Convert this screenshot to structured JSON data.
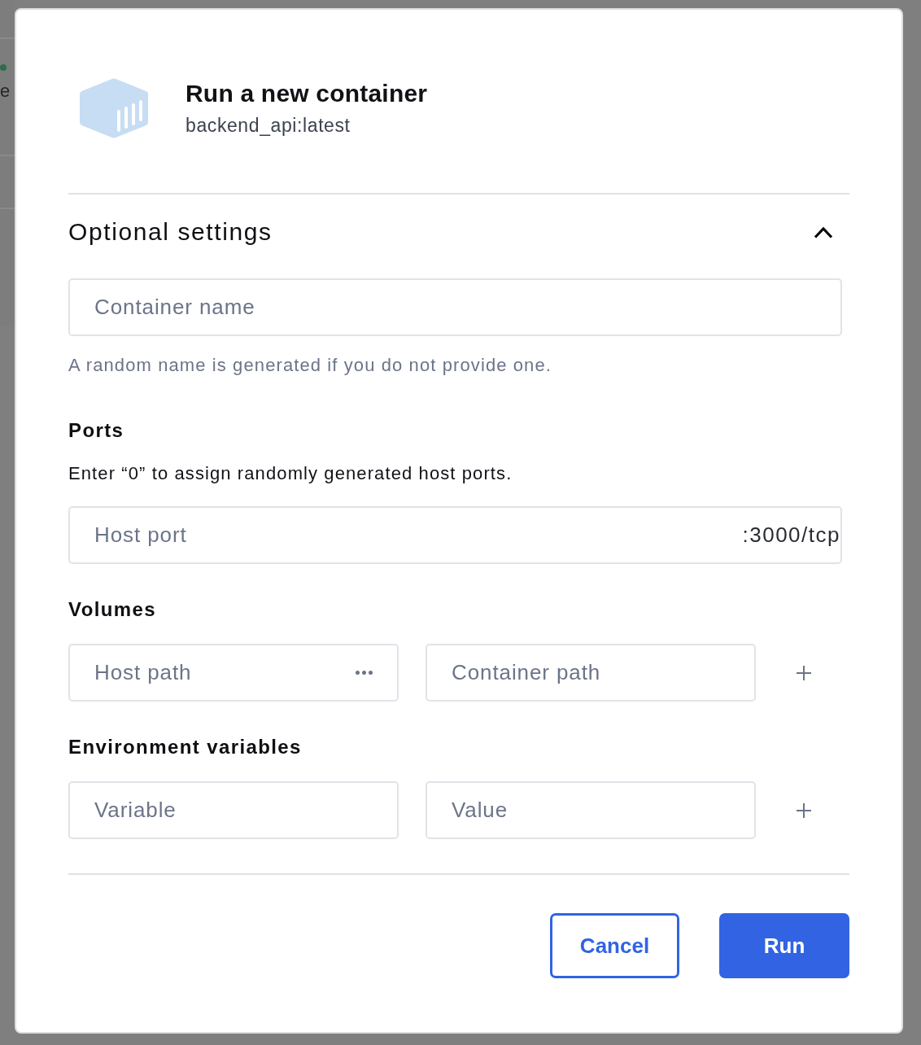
{
  "background": {
    "label": "e",
    "color": "#2f6b4e"
  },
  "dialog": {
    "title": "Run a new container",
    "subtitle": "backend_api:latest"
  },
  "optional_settings": {
    "title": "Optional settings",
    "expanded": true,
    "container_name": {
      "placeholder": "Container name",
      "hint": "A random name is generated if you do not provide one."
    },
    "sections": [
      {
        "kind": "ports",
        "title": "Ports",
        "description": "Enter “0” to assign randomly generated host ports.",
        "field": {
          "placeholder": "Host port",
          "suffix": ":3000/tcp"
        }
      },
      {
        "kind": "pair",
        "title": "Volumes",
        "fields": [
          {
            "placeholder": "Host path",
            "browse": true
          },
          {
            "placeholder": "Container path",
            "browse": false
          }
        ]
      },
      {
        "kind": "pair",
        "title": "Environment variables",
        "fields": [
          {
            "placeholder": "Variable",
            "browse": false
          },
          {
            "placeholder": "Value",
            "browse": false
          }
        ]
      }
    ]
  },
  "buttons": [
    {
      "label": "Cancel",
      "kind": "secondary"
    },
    {
      "label": "Run",
      "kind": "primary"
    }
  ]
}
